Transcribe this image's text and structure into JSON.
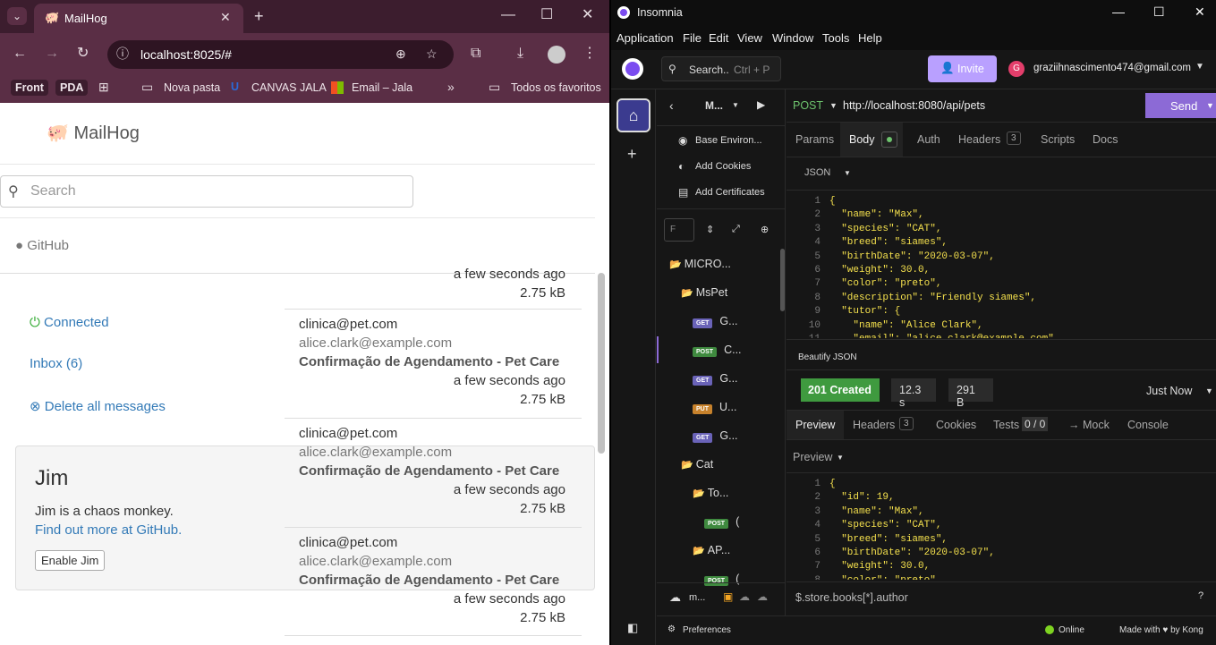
{
  "browser": {
    "tab_title": "MailHog",
    "url": "localhost:8025/#",
    "bookmarks": [
      "Front",
      "PDA",
      "Nova pasta",
      "CANVAS JALA",
      "Email – Jala",
      "Todos os favoritos"
    ]
  },
  "mailhog": {
    "brand": "MailHog",
    "search_placeholder": "Search",
    "github": "GitHub",
    "connected": "Connected",
    "inbox": "Inbox (6)",
    "delete_all": "Delete all messages",
    "top_time": "a few seconds ago",
    "top_size": "2.75 kB",
    "messages": [
      {
        "from": "clinica@pet.com",
        "to": "alice.clark@example.com",
        "subject": "Confirmação de Agendamento - Pet Care",
        "time": "a few seconds ago",
        "size": "2.75 kB"
      },
      {
        "from": "clinica@pet.com",
        "to": "alice.clark@example.com",
        "subject": "Confirmação de Agendamento - Pet Care",
        "time": "a few seconds ago",
        "size": "2.75 kB"
      },
      {
        "from": "clinica@pet.com",
        "to": "alice.clark@example.com",
        "subject": "Confirmação de Agendamento - Pet Care",
        "time": "a few seconds ago",
        "size": "2.75 kB"
      }
    ],
    "jim": {
      "title": "Jim",
      "text": "Jim is a chaos monkey.",
      "link": "Find out more at GitHub.",
      "button": "Enable Jim"
    }
  },
  "insomnia": {
    "app_title": "Insomnia",
    "menu": [
      "Application",
      "File",
      "Edit",
      "View",
      "Window",
      "Tools",
      "Help"
    ],
    "search": "Search..",
    "search_shortcut": "Ctrl + P",
    "invite": "Invite",
    "user_initial": "G",
    "user": "graziihnascimento474@gmail.com",
    "project": "M...",
    "base_env": "Base Environ...",
    "cookies": "Add Cookies",
    "certs": "Add Certificates",
    "filter": "F",
    "tree": [
      {
        "label": "MICRO...",
        "type": "folder"
      },
      {
        "label": "MsPet",
        "type": "folder"
      },
      {
        "label": "G...",
        "method": "GET"
      },
      {
        "label": "C...",
        "method": "POST"
      },
      {
        "label": "G...",
        "method": "GET"
      },
      {
        "label": "U...",
        "method": "PUT"
      },
      {
        "label": "G...",
        "method": "GET"
      },
      {
        "label": "Cat",
        "type": "folder"
      },
      {
        "label": "To...",
        "type": "folder"
      },
      {
        "label": "(",
        "method": "POST"
      },
      {
        "label": "AP...",
        "type": "folder"
      },
      {
        "label": "(",
        "method": "POST"
      }
    ],
    "workspace_short": "m...",
    "request": {
      "method": "POST",
      "url": "http://localhost:8080/api/pets",
      "send": "Send"
    },
    "req_tabs": {
      "params": "Params",
      "body": "Body",
      "auth": "Auth",
      "headers": "Headers",
      "headers_count": "3",
      "scripts": "Scripts",
      "docs": "Docs"
    },
    "body_type": "JSON",
    "body_lines": [
      {
        "n": "1",
        "t": "{"
      },
      {
        "n": "2",
        "t": "  \"name\": \"Max\","
      },
      {
        "n": "3",
        "t": "  \"species\": \"CAT\","
      },
      {
        "n": "4",
        "t": "  \"breed\": \"siames\","
      },
      {
        "n": "5",
        "t": "  \"birthDate\": \"2020-03-07\","
      },
      {
        "n": "6",
        "t": "  \"weight\": 30.0,"
      },
      {
        "n": "7",
        "t": "  \"color\": \"preto\","
      },
      {
        "n": "8",
        "t": "  \"description\": \"Friendly siames\","
      },
      {
        "n": "9",
        "t": "  \"tutor\": {"
      },
      {
        "n": "10",
        "t": "    \"name\": \"Alice Clark\","
      },
      {
        "n": "11",
        "t": "    \"email\": \"alice.clark@example.com\""
      }
    ],
    "beautify": "Beautify JSON",
    "response": {
      "status": "201 Created",
      "time": "12.3 s",
      "size": "291 B",
      "when": "Just Now"
    },
    "resp_tabs": {
      "preview": "Preview",
      "headers": "Headers",
      "headers_count": "3",
      "cookies": "Cookies",
      "tests": "Tests",
      "tests_count": "0 / 0",
      "mock": "→ Mock",
      "console": "Console"
    },
    "preview_mode": "Preview",
    "resp_lines": [
      {
        "n": "1",
        "t": "{"
      },
      {
        "n": "2",
        "t": "  \"id\": 19,"
      },
      {
        "n": "3",
        "t": "  \"name\": \"Max\","
      },
      {
        "n": "4",
        "t": "  \"species\": \"CAT\","
      },
      {
        "n": "5",
        "t": "  \"breed\": \"siames\","
      },
      {
        "n": "6",
        "t": "  \"birthDate\": \"2020-03-07\","
      },
      {
        "n": "7",
        "t": "  \"weight\": 30.0,"
      },
      {
        "n": "8",
        "t": "  \"color\": \"preto\","
      }
    ],
    "filter_query": "$.store.books[*].author",
    "preferences": "Preferences",
    "online": "Online",
    "made_with": "Made with ♥ by Kong"
  }
}
